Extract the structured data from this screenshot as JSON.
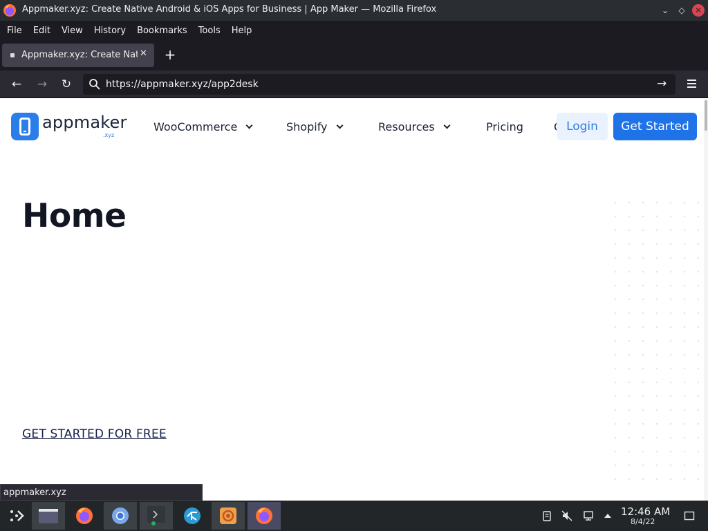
{
  "window": {
    "title": "Appmaker.xyz: Create Native Android & iOS Apps for Business | App Maker — Mozilla Firefox",
    "min_glyph": "⌄",
    "max_glyph": "◇",
    "close_glyph": "✕"
  },
  "menubar": {
    "items": [
      "File",
      "Edit",
      "View",
      "History",
      "Bookmarks",
      "Tools",
      "Help"
    ]
  },
  "tabs": {
    "active_tab_label": "Appmaker.xyz: Create Nati",
    "close_glyph": "✕",
    "new_tab_glyph": "+"
  },
  "navbar": {
    "back_glyph": "←",
    "forward_glyph": "→",
    "reload_glyph": "↻",
    "url": "https://appmaker.xyz/app2desk",
    "go_glyph": "→"
  },
  "site": {
    "logo_word": "appmaker",
    "logo_tld": ".xyz",
    "nav": {
      "woocommerce": "WooCommerce",
      "shopify": "Shopify",
      "resources": "Resources",
      "pricing": "Pricing",
      "cut_letter": "C"
    },
    "login_label": "Login",
    "get_started_label": "Get Started",
    "page_title": "Home",
    "cta_link": "GET STARTED FOR FREE"
  },
  "status_tooltip": "appmaker.xyz",
  "taskbar": {
    "time": "12:46 AM",
    "date": "8/4/22"
  },
  "colors": {
    "brand_blue": "#1f73e8",
    "login_bg": "#eaf2fe",
    "heading": "#111622"
  }
}
